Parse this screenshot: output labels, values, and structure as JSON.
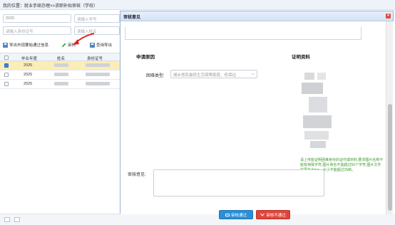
{
  "breadcrumb": "我的位置：就业手续办理>>求职补贴审核（学校）",
  "filters": {
    "year_value": "2025",
    "student_no_placeholder": "请输入学号",
    "id_card_placeholder": "请输入身份证号",
    "name_placeholder": "请输入姓名"
  },
  "toolbar": {
    "export_label": "导出市现要始通过信息",
    "audit_label": "审核",
    "query_export_label": "查询导出"
  },
  "table": {
    "headers": [
      "毕业年度",
      "姓名",
      "身份证号"
    ],
    "rows": [
      {
        "year": "2025",
        "selected": true
      },
      {
        "year": "2025",
        "selected": false
      },
      {
        "year": "2025",
        "selected": false
      }
    ]
  },
  "modal": {
    "title": "审核意见",
    "close_glyph": "×",
    "section_reason": "申请原因",
    "section_proof": "证明资料",
    "difficulty_label": "困难类型:",
    "difficulty_value": "城乡居民最低生活保障家庭、低保边",
    "caret_glyph": "⌵",
    "note": "请上传能证明困难身份的证件或材料,要求图片名称不能有特殊字符,图片命名不能超过50个字符,图片文件扩展名为jpg、大小不能超过2MB。",
    "opinion_label": "审核意见:",
    "pass_label": "审核通过",
    "fail_label": "审核不通过"
  },
  "colors": {
    "accent": "#2a8fd6",
    "danger": "#e1453a",
    "selected_row": "#fbecb8",
    "note_green": "#3f9a2c"
  }
}
